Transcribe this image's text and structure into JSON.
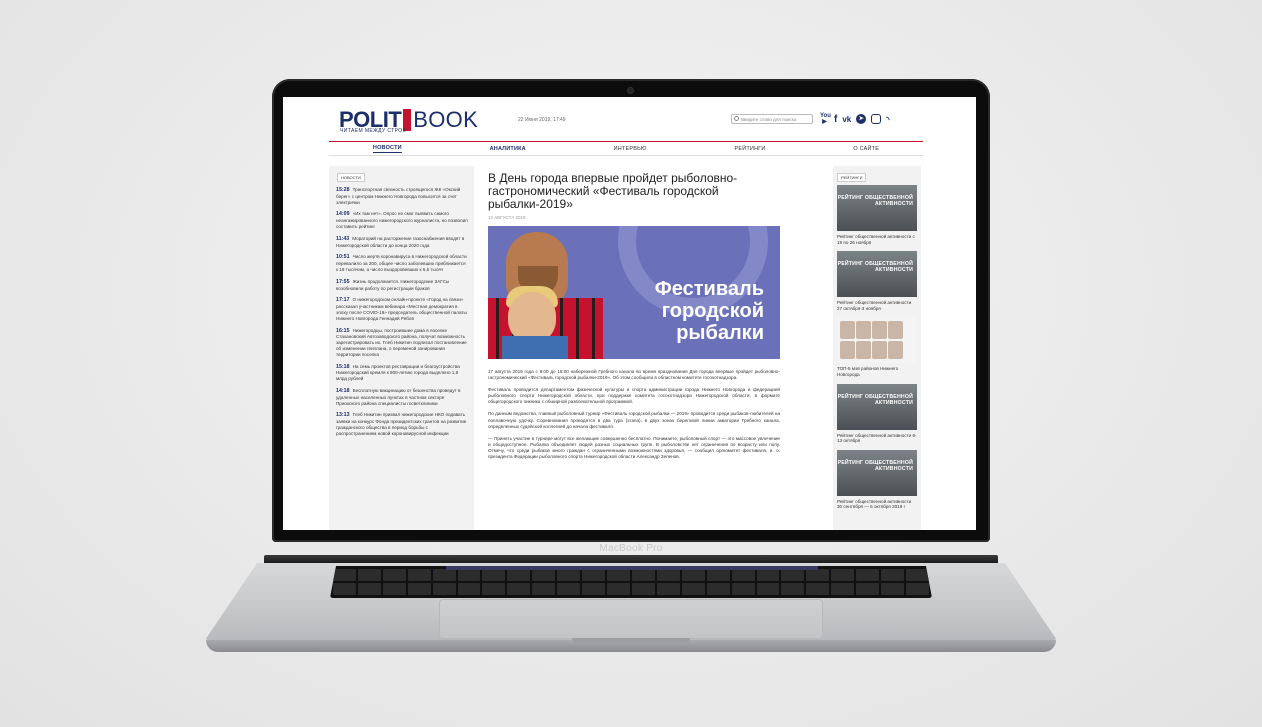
{
  "device": {
    "label": "MacBook Pro"
  },
  "header": {
    "logo_left": "POLIT",
    "logo_right": "BOOK",
    "tagline": "ЧИТАЕМ МЕЖДУ СТРОК",
    "date": "22 Июня 2019, 17:49",
    "search_placeholder": "Введите слово для поиска",
    "socials": [
      "youtube-icon",
      "facebook-icon",
      "vk-icon",
      "telegram-icon",
      "instagram-icon",
      "rss-icon"
    ]
  },
  "nav": {
    "items": [
      "НОВОСТИ",
      "АНАЛИТИКА",
      "ИНТЕРВЬЮ",
      "РЕЙТИНГИ",
      "О САЙТЕ"
    ]
  },
  "left": {
    "section": "НОВОСТИ",
    "news": [
      {
        "time": "15:28",
        "text": "Транспортная связность строящегося ЖК «Окский берег» с центром Нижнего Новгорода повысится за счет электрички"
      },
      {
        "time": "14:09",
        "text": "«Их там нет». Опрос не смог выявить самого неангажированного нижегородского журналиста, но позволил составить рейтинг"
      },
      {
        "time": "11:43",
        "text": "Мораторий на расторжение газоснабжения вводят в Нижегородской области до конца 2020 года"
      },
      {
        "time": "10:51",
        "text": "Число жертв коронавируса в Нижегородской области перевалило за 200, общее число заболевших приближается к 16 тысячам, а число выздоровевших к 6,5 тысяч"
      },
      {
        "time": "17:55",
        "text": "Жизнь продолжается. Нижегородские ЗАГСы возобновили работу по регистрации браков"
      },
      {
        "time": "17:17",
        "text": "О нижегородском онлайн-проекте «Город на связи» рассказал участникам вебинара «Местная демократия в эпоху после COVID-19» председатель общественной палаты Нижнего Новгорода Геннадий Рябов"
      },
      {
        "time": "16:15",
        "text": "Нижегородцы, построившие дома в поселке Стахановский Автозаводского района, получат возможность зарегистрировать их. Глеб Никитин подписал постановление об изменении генплана, о переменой зонирования территории поселка"
      },
      {
        "time": "15:18",
        "text": "На семь проектов реставрации и благоустройства Нижегородский кремля к 800-летию города выделено 1,8 млрд рублей"
      },
      {
        "time": "14:18",
        "text": "Бесплатную вакцинацию от бешенства проведут в удаленных населенных пунктах в частном секторе Приокского района специалисты госветклиники"
      },
      {
        "time": "13:13",
        "text": "Глеб Никитин призвал нижегородские НКО подавать заявки на конкурс Фонда президентских грантов на развитие гражданского общества в период борьбы с распространением новой коронавирусной инфекции"
      }
    ]
  },
  "article": {
    "title": "В День города впервые пройдет рыболовно-гастрономический «Фестиваль городской рыбалки-2019»",
    "date": "12 АВГУСТА 2019",
    "hero_text": "Фестиваль городской рыбалки",
    "p1": "17 августа 2019 года с 9:00 до 15:00 набережной Гребного канала во время празднования Дня города впервые пройдет рыболовно-гастрономический «Фестиваль городской рыбалки-2019». Об этом сообщили в областном комитете госохотнадзора.",
    "p2": "Фестиваль проводится департаментом физической культуры и спорта администрации города Нижнего Новгорода и федерацией рыболовного спорта Нижегородской области, при поддержке комитета госохотнадзора Нижегородской области, в формате общегородского пикника с обширной развлекательной программой.",
    "p3": "По данным ведомства, главный рыболовный турнир «Фестиваль городской рыбалки — 2019» проводится среди рыбаков-любителей на поплавочную удочку. Соревнования проводятся в два тура (этапа), в двух зонах береговой линии акватории Гребного канала, определенных судейской коллегией до начала фестиваля.",
    "p4": "— Принять участие в турнире могут все желающие совершенно бесплатно. Понимаете, рыболовный спорт — это массовое увлечение и общедоступное. Рыбалка объединяет людей разных социальных групп. В рыболовстве нет ограничения по возрасту или полу. Отмечу, что среди рыбаков много граждан с ограниченными возможностями здоровья, — сообщил оргкомитет фестиваля, и. о. президента Федерации рыболовного спорта Нижегородской области Александр Зеленов."
  },
  "right": {
    "section": "РЕЙТИНГИ",
    "cards": [
      {
        "thumb": "РЕЙТИНГ ОБЩЕСТВЕННОЙ АКТИВНОСТИ",
        "caption": "Рейтинг общественной активности с 19 по 26 ноября"
      },
      {
        "thumb": "РЕЙТИНГ ОБЩЕСТВЕННОЙ АКТИВНОСТИ",
        "caption": "Рейтинг общественной активности 27 октября-3 ноября"
      },
      {
        "thumb": "",
        "caption": "ТОП-5 мэв районов Нижнего Новгорода"
      },
      {
        "thumb": "РЕЙТИНГ ОБЩЕСТВЕННОЙ АКТИВНОСТИ",
        "caption": "Рейтинг общественной активности 6-13 октября"
      },
      {
        "thumb": "РЕЙТИНГ ОБЩЕСТВЕННОЙ АКТИВНОСТИ",
        "caption": "Рейтинг общественной активности 30 сентября — 6 октября 2019 г"
      }
    ]
  }
}
